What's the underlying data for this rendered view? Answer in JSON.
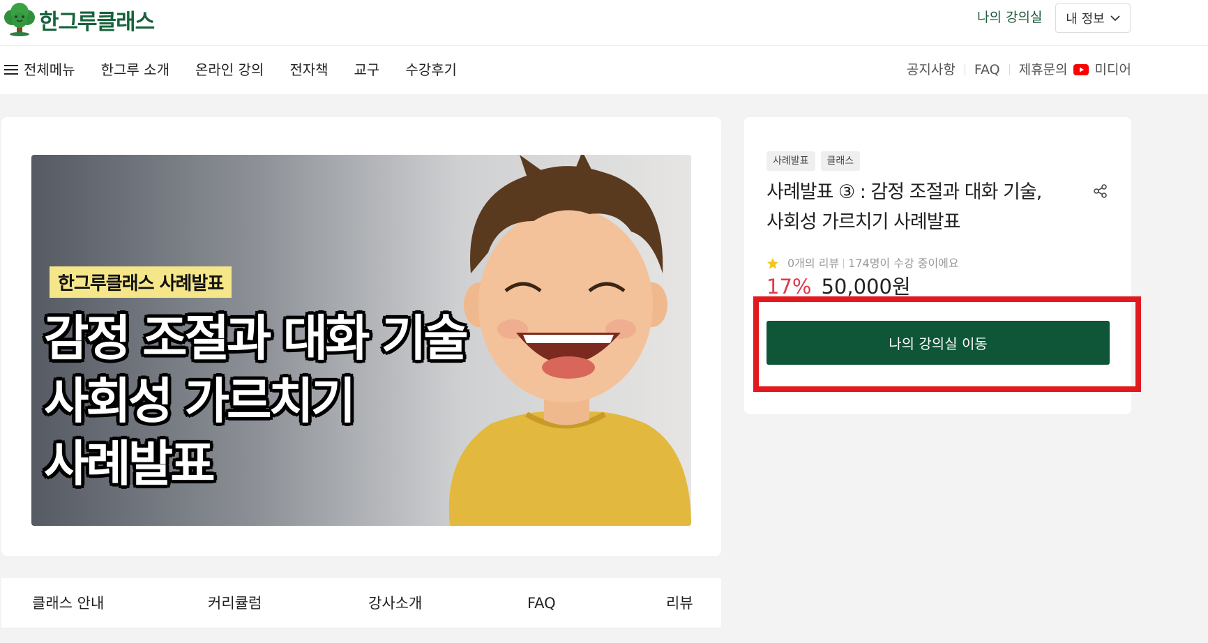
{
  "header": {
    "logo_text": "한그루클래스",
    "my_class_link": "나의 강의실",
    "my_info_label": "내 정보"
  },
  "nav": {
    "menu_label": "전체메뉴",
    "items": [
      "한그루 소개",
      "온라인 강의",
      "전자책",
      "교구",
      "수강후기"
    ],
    "right_items": [
      "공지사항",
      "FAQ",
      "제휴문의"
    ],
    "media_label": "미디어"
  },
  "hero": {
    "tag": "한그루클래스 사례발표",
    "title_lines": [
      "감정 조절과 대화 기술",
      "사회성 가르치기",
      "사례발표"
    ]
  },
  "course": {
    "badges": [
      "사례발표",
      "클래스"
    ],
    "title_line1": "사례발표 ③ : 감정 조절과 대화 기술,",
    "title_line2": "사회성 가르치기 사례발표",
    "reviews": "0개의 리뷰",
    "students": "174명이 수강 중이에요",
    "discount": "17%",
    "price": "50,000원",
    "button_label": "나의 강의실 이동"
  },
  "tabs": [
    "클래스 안내",
    "커리큘럼",
    "강사소개",
    "FAQ",
    "리뷰"
  ],
  "colors": {
    "brand_green": "#15633b",
    "button_green": "#0f5537",
    "discount_red": "#e03a4a",
    "highlight_red": "#e11a1f",
    "star_yellow": "#f5c518"
  }
}
